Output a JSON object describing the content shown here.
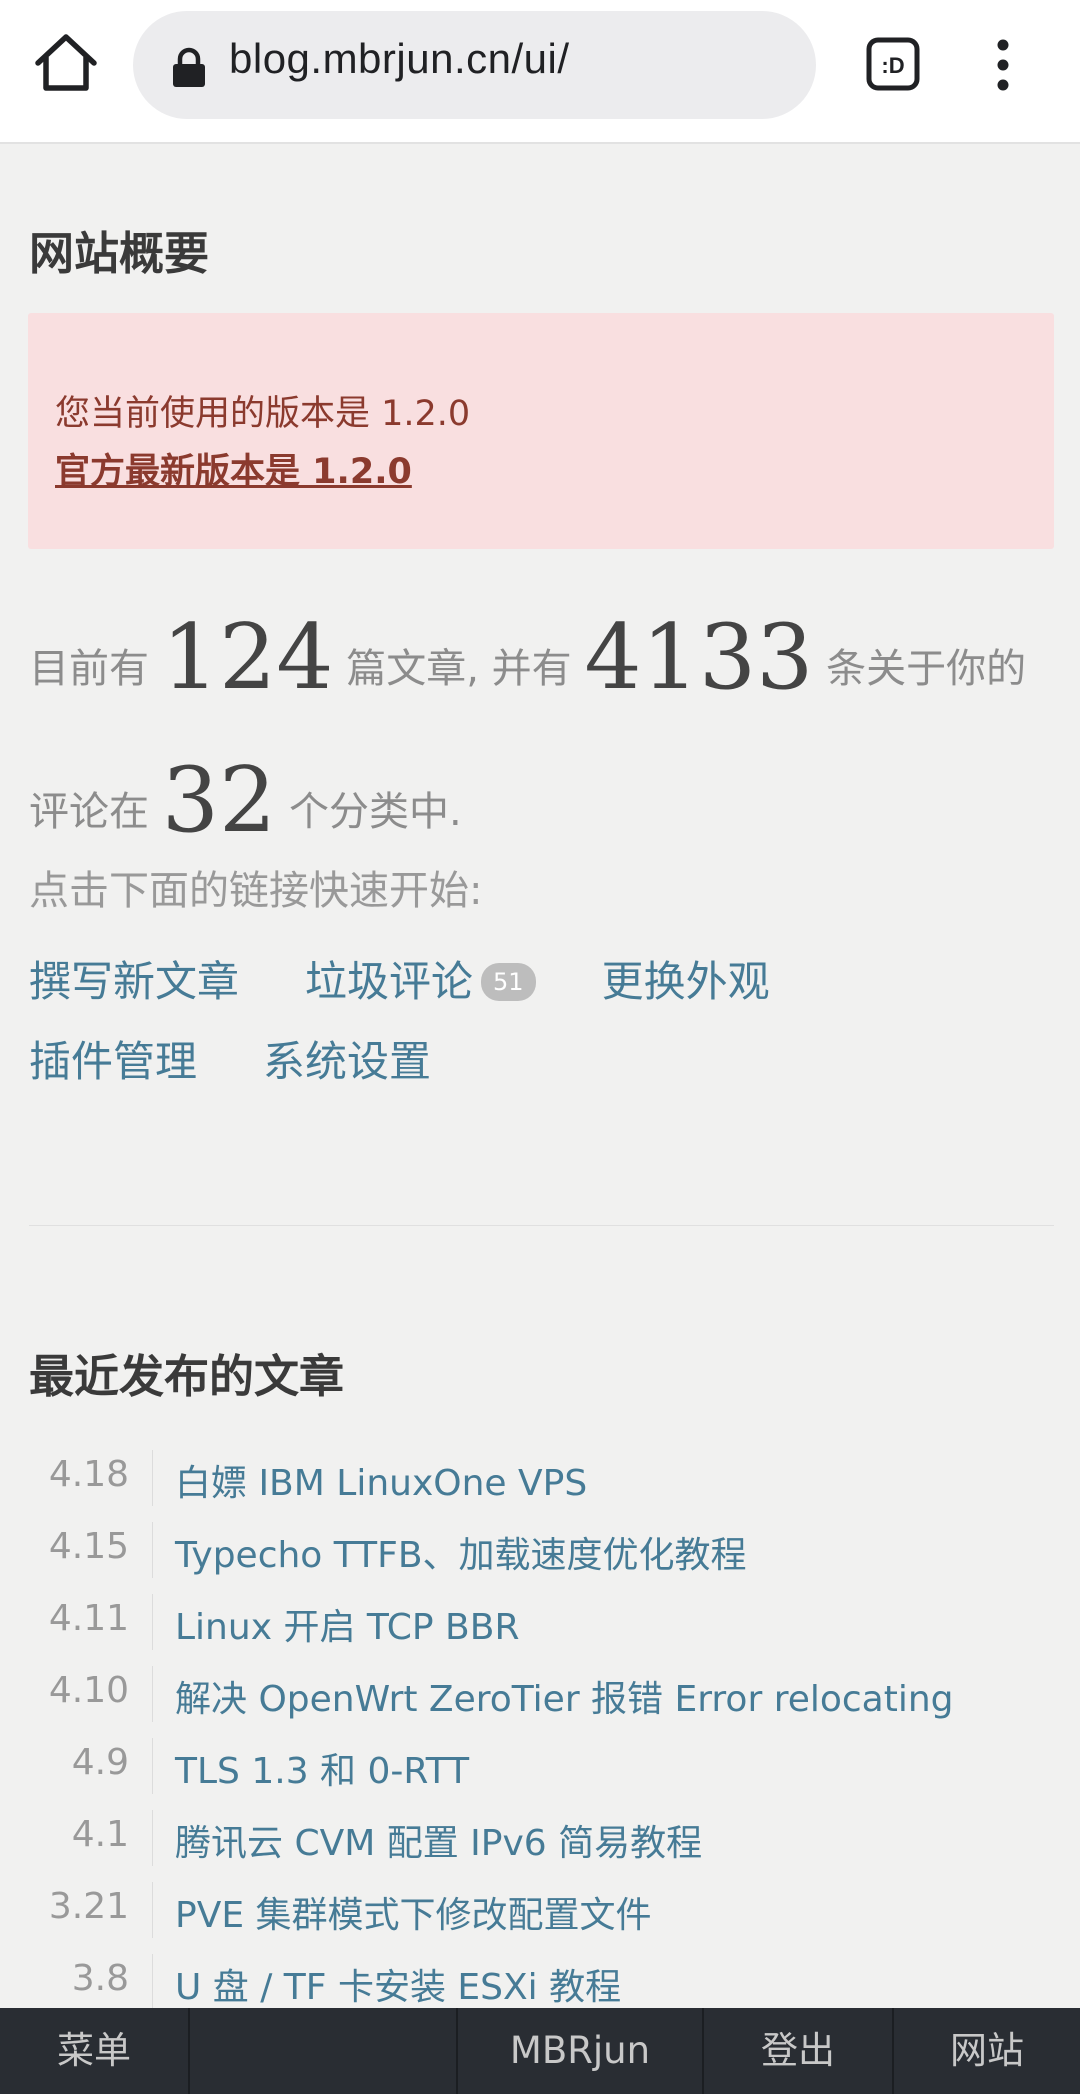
{
  "browser": {
    "url": "blog.mbrjun.cn/ui/",
    "tab_label": ":D"
  },
  "overview": {
    "title": "网站概要",
    "version_current": "您当前使用的版本是 1.2.0",
    "version_latest": "官方最新版本是 1.2.0",
    "stats": {
      "prefix": "目前有",
      "posts": "124",
      "posts_suffix": "篇文章, 并有",
      "comments": "4133",
      "comments_suffix": "条关于你的评论在",
      "categories": "32",
      "categories_suffix": "个分类中."
    },
    "quick_start": "点击下面的链接快速开始:",
    "links": {
      "write": "撰写新文章",
      "spam": "垃圾评论",
      "spam_count": "51",
      "themes": "更换外观",
      "plugins": "插件管理",
      "settings": "系统设置"
    }
  },
  "recent": {
    "title": "最近发布的文章",
    "posts": [
      {
        "date": "4.18",
        "title": "白嫖 IBM LinuxOne VPS"
      },
      {
        "date": "4.15",
        "title": "Typecho TTFB、加载速度优化教程"
      },
      {
        "date": "4.11",
        "title": "Linux 开启 TCP BBR"
      },
      {
        "date": "4.10",
        "title": "解决 OpenWrt ZeroTier 报错 Error relocating"
      },
      {
        "date": "4.9",
        "title": "TLS 1.3 和 0-RTT"
      },
      {
        "date": "4.1",
        "title": "腾讯云 CVM 配置 IPv6 简易教程"
      },
      {
        "date": "3.21",
        "title": "PVE 集群模式下修改配置文件"
      },
      {
        "date": "3.8",
        "title": "U 盘 / TF 卡安装 ESXi 教程"
      }
    ]
  },
  "bottom_nav": {
    "menu": "菜单",
    "user": "MBRjun",
    "logout": "登出",
    "site": "网站"
  },
  "colors": {
    "link": "#467b96",
    "alert_bg": "#f9dfe0",
    "alert_text": "#8b3a2e",
    "bottom_bar": "#292d33"
  }
}
